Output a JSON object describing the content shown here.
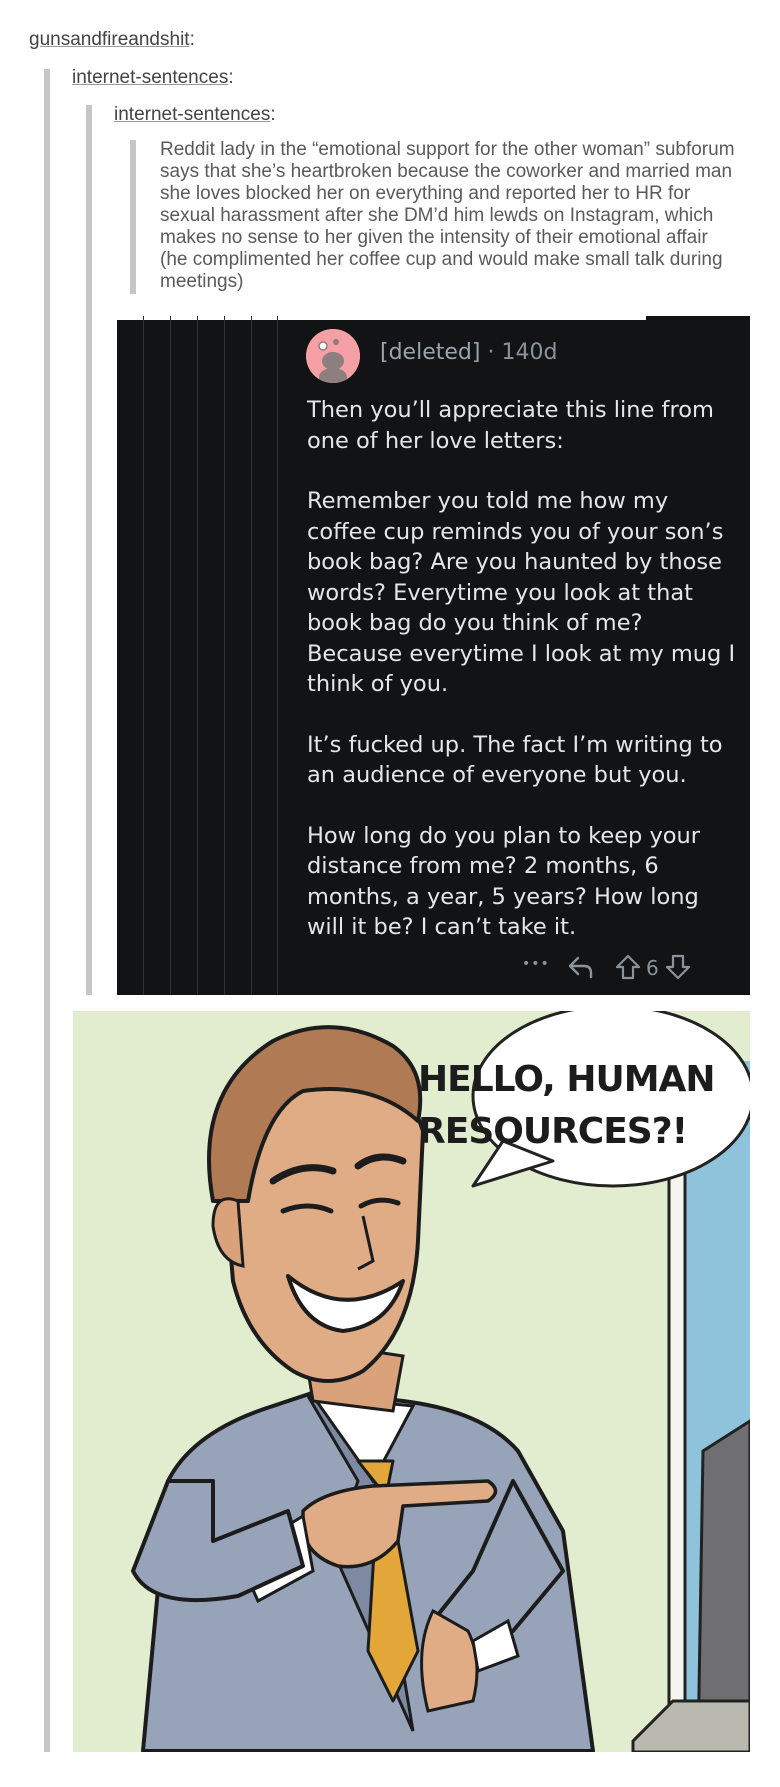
{
  "thread": {
    "op_user": "gunsandfireandshit",
    "reblog1_user": "internet-sentences",
    "reblog2_user": "internet-sentences",
    "colon": ":",
    "original_text": "Reddit lady in the “emotional support for the other woman” subforum says that she’s heartbroken because the coworker and married man she loves blocked her on everything and reported her to HR for sexual harassment after she DM’d him lewds on Instagram, which makes no sense to her given the intensity of their emotional affair (he complimented her coffee cup and would make small talk during meetings)"
  },
  "reddit_comment": {
    "username": "[deleted]",
    "separator": "·",
    "age": "140d",
    "paragraphs": [
      "Then you’ll appreciate this line from one of her love letters:",
      "Remember you told me how my coffee cup reminds you of your son’s book bag? Are you haunted by those words? Everytime you look at that book bag do you think of me? Because everytime I look at my mug I think of you.",
      "It’s fucked up. The fact I’m writing to an audience of everyone but you.",
      "How long do you plan to keep your distance from me? 2 months, 6 months, a year, 5 years? How long will it be? I can’t take it."
    ],
    "more_label": "•••",
    "vote_count": "6",
    "icons": {
      "avatar": "snoo-avatar-icon",
      "more": "more-dots-icon",
      "reply": "reply-icon",
      "upvote": "upvote-icon",
      "downvote": "downvote-icon"
    },
    "colors": {
      "background": "#121314",
      "text": "#e4e6e7",
      "meta": "#8a939c",
      "avatar": "#f4a0a4"
    }
  },
  "comic": {
    "speech_line1": "HELLO, HUMAN",
    "speech_line2": "RESOURCES?!"
  }
}
